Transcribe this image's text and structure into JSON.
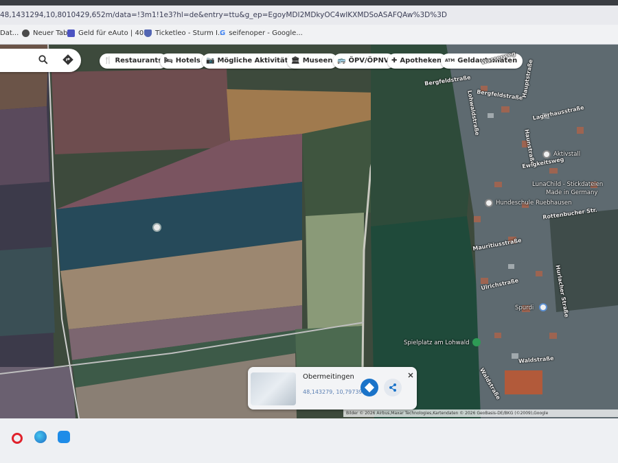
{
  "browser": {
    "url_fragment": "48,1431294,10,8010429,652m/data=!3m1!1e3?hl=de&entry=ttu&g_ep=EgoyMDI2MDkyOC4wIKXMDSoASAFQAw%3D%3D",
    "bookmarks": [
      {
        "label": "Dat...",
        "icon": "folder-icon"
      },
      {
        "label": "Neuer Tab",
        "icon": "globe-icon"
      },
      {
        "label": "Geld für eAuto | 40...",
        "icon": "heart-icon"
      },
      {
        "label": "Ticketleo - Sturm I...",
        "icon": "shield-icon"
      },
      {
        "label": "seifenoper - Google...",
        "icon": "google-icon"
      }
    ]
  },
  "map": {
    "search_icon": "search-icon",
    "directions_icon": "directions-icon",
    "chips": [
      {
        "label": "Restaurants",
        "icon": "fork-knife-icon"
      },
      {
        "label": "Hotels",
        "icon": "bed-icon"
      },
      {
        "label": "Mögliche Aktivitäten",
        "icon": "camera-icon"
      },
      {
        "label": "Museen",
        "icon": "museum-icon"
      },
      {
        "label": "ÖPV/ÖPNV",
        "icon": "bus-icon"
      },
      {
        "label": "Apotheken",
        "icon": "pharmacy-icon"
      },
      {
        "label": "Geldautomaten",
        "icon": "atm-icon"
      }
    ],
    "streets": [
      "Bergfeldstraße",
      "Bergfeldstraße",
      "Lohwaldstraße",
      "Lagerhausstraße",
      "Haunstraße",
      "Hauptstraße",
      "Ewigkeitsweg",
      "Mauritiusstraße",
      "Ulrichstraße",
      "Hurlacher Straße",
      "Waldstraße",
      "Rottenbucher Str.",
      "Wasserweg",
      "Waldstraße"
    ],
    "pois": [
      {
        "label": "Aktivstall"
      },
      {
        "label": "LunaChild - Stickdateien"
      },
      {
        "label": "Made in Germany"
      },
      {
        "label": "Hundeschule Ruebhausen"
      },
      {
        "label": "Spurdi"
      },
      {
        "label": "Spielplatz am Lohwald"
      }
    ],
    "attribution": "Bilder © 2026 Airbus,Maxar Technologies,Kartendaten © 2026 GeoBasis-DE/BKG (©2009),Google"
  },
  "place_card": {
    "title": "Obermeitingen",
    "coords": "48,143279, 10,797395",
    "close_icon": "close-icon",
    "directions_icon": "directions-icon",
    "share_icon": "share-icon"
  },
  "taskbar": {
    "icons": [
      "opera-icon",
      "edge-icon",
      "app-icon"
    ]
  }
}
